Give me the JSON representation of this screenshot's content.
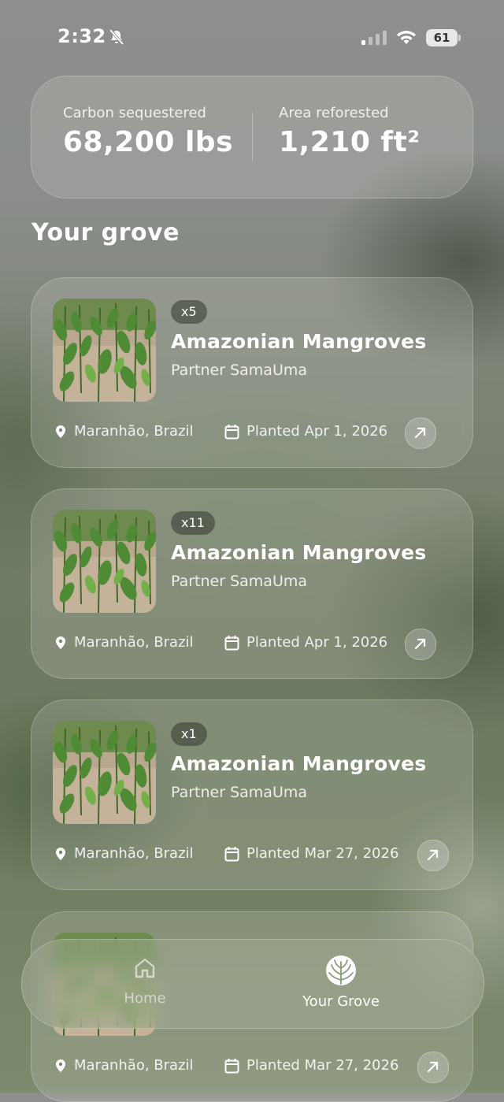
{
  "status_bar": {
    "time": "2:32",
    "battery": "61"
  },
  "stats": {
    "carbon": {
      "label": "Carbon sequestered",
      "value": "68,200 lbs"
    },
    "area": {
      "label": "Area reforested",
      "value": "1,210 ft²"
    }
  },
  "section_title": "Your grove",
  "cards": [
    {
      "count": "x5",
      "title": "Amazonian Mangroves",
      "partner": "Partner SamaUma",
      "location": "Maranhão, Brazil",
      "planted": "Planted Apr 1, 2026"
    },
    {
      "count": "x11",
      "title": "Amazonian Mangroves",
      "partner": "Partner SamaUma",
      "location": "Maranhão, Brazil",
      "planted": "Planted Apr 1, 2026"
    },
    {
      "count": "x1",
      "title": "Amazonian Mangroves",
      "partner": "Partner SamaUma",
      "location": "Maranhão, Brazil",
      "planted": "Planted Mar 27, 2026"
    },
    {
      "count": "",
      "title": "",
      "partner": "",
      "location": "Maranhão, Brazil",
      "planted": "Planted Mar 27, 2026"
    }
  ],
  "tabbar": {
    "home": "Home",
    "grove": "Your Grove"
  }
}
